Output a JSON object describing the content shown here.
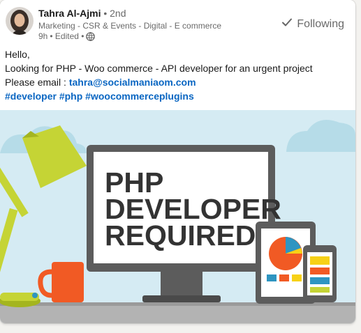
{
  "post": {
    "author": {
      "name": "Tahra Al-Ajmi",
      "degree": "• 2nd",
      "headline": "Marketing - CSR & Events - Digital - E commerce",
      "time": "9h",
      "edited": "• Edited •",
      "visibility_icon": "globe-icon"
    },
    "follow": {
      "icon": "checkmark-icon",
      "label": "Following"
    },
    "body": {
      "greeting": "Hello,",
      "line1": "Looking for PHP - Woo commerce - API developer for an urgent project",
      "email_prefix": "Please email : ",
      "email": "tahra@socialmaniaom.com",
      "hashtags": [
        "#developer",
        "#php",
        "#woocommerceplugins"
      ]
    },
    "image": {
      "headline_lines": [
        "PHP",
        "DEVELOPER",
        "REQUIRED"
      ]
    }
  },
  "colors": {
    "sky": "#d5ebf3",
    "cloud": "#b6dce8",
    "lamp": "#c5d435",
    "mug": "#f15a24",
    "monitor_frame": "#5c5c5c",
    "desk": "#b3b3b3",
    "link": "#0a66c2"
  }
}
